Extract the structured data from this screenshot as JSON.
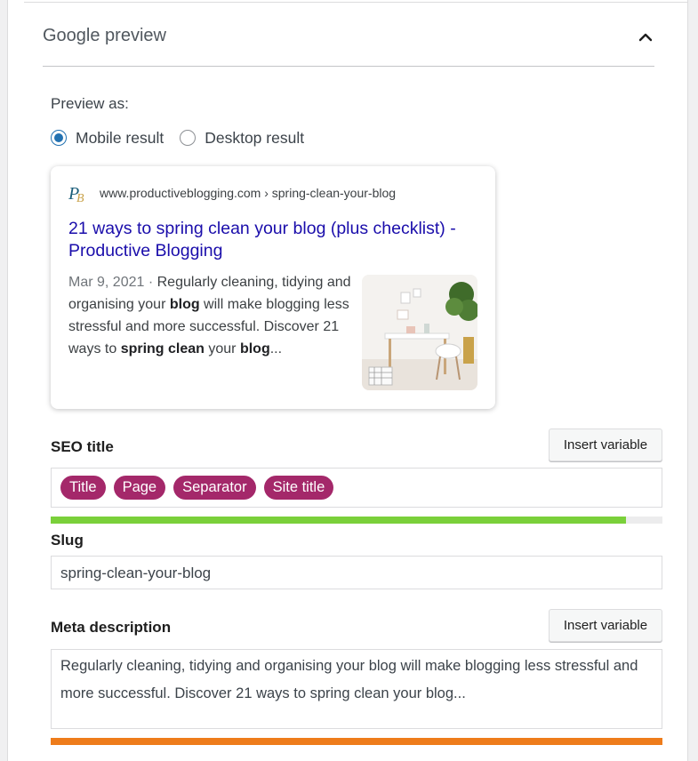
{
  "section": {
    "title": "Google preview",
    "toggle_icon": "chevron-up-icon"
  },
  "preview": {
    "label": "Preview as:",
    "options": [
      {
        "label": "Mobile result",
        "checked": true
      },
      {
        "label": "Desktop result",
        "checked": false
      }
    ]
  },
  "serp": {
    "favicon": "PB",
    "url": "www.productiveblogging.com › spring-clean-your-blog",
    "title": "21 ways to spring clean your blog (plus checklist) - Productive Blogging",
    "date": "Mar 9, 2021 · ",
    "desc_1": "Regularly cleaning, tidying and organising your ",
    "desc_b1": "blog",
    "desc_2": " will make blogging less stressful and more successful. Discover 21 ways to ",
    "desc_b2": "spring clean",
    "desc_3": " your ",
    "desc_b3": "blog",
    "desc_4": "...",
    "thumbnail": "desk-with-chair-and-plant-image"
  },
  "seo_title": {
    "label": "SEO title",
    "insert_label": "Insert variable",
    "tags": [
      "Title",
      "Page",
      "Separator",
      "Site title"
    ],
    "progress": 0.94,
    "progress_color": "#7ad03a"
  },
  "slug": {
    "label": "Slug",
    "value": "spring-clean-your-blog"
  },
  "meta": {
    "label": "Meta description",
    "insert_label": "Insert variable",
    "value": "Regularly cleaning, tidying and organising your blog will make blogging less stressful and more successful. Discover 21 ways to spring clean your blog...",
    "progress": 1.0,
    "progress_color": "#ee7c1b"
  },
  "colors": {
    "accent": "#2271b1",
    "tag": "#a4286a",
    "link": "#1a0dab"
  }
}
